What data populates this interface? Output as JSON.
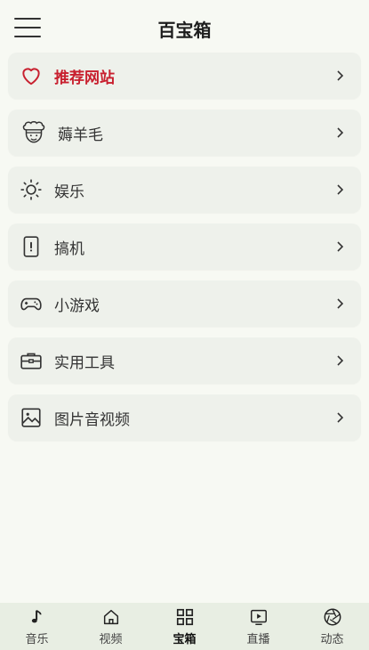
{
  "header": {
    "title": "百宝箱"
  },
  "items": [
    {
      "label": "推荐网站",
      "icon": "heart-icon"
    },
    {
      "label": "薅羊毛",
      "icon": "chef-face-icon"
    },
    {
      "label": "娱乐",
      "icon": "sun-icon"
    },
    {
      "label": "搞机",
      "icon": "phone-icon"
    },
    {
      "label": "小游戏",
      "icon": "gamepad-icon"
    },
    {
      "label": "实用工具",
      "icon": "toolbox-icon"
    },
    {
      "label": "图片音视频",
      "icon": "image-icon"
    }
  ],
  "tabs": [
    {
      "label": "音乐",
      "icon": "music-note-icon"
    },
    {
      "label": "视频",
      "icon": "home-icon"
    },
    {
      "label": "宝箱",
      "icon": "grid-icon",
      "active": true
    },
    {
      "label": "直播",
      "icon": "play-screen-icon"
    },
    {
      "label": "动态",
      "icon": "aperture-icon"
    }
  ],
  "colors": {
    "accent": "#c8202f",
    "background": "#f7f9f3",
    "card": "#eef1eb",
    "tabbar": "#e8eee3"
  }
}
